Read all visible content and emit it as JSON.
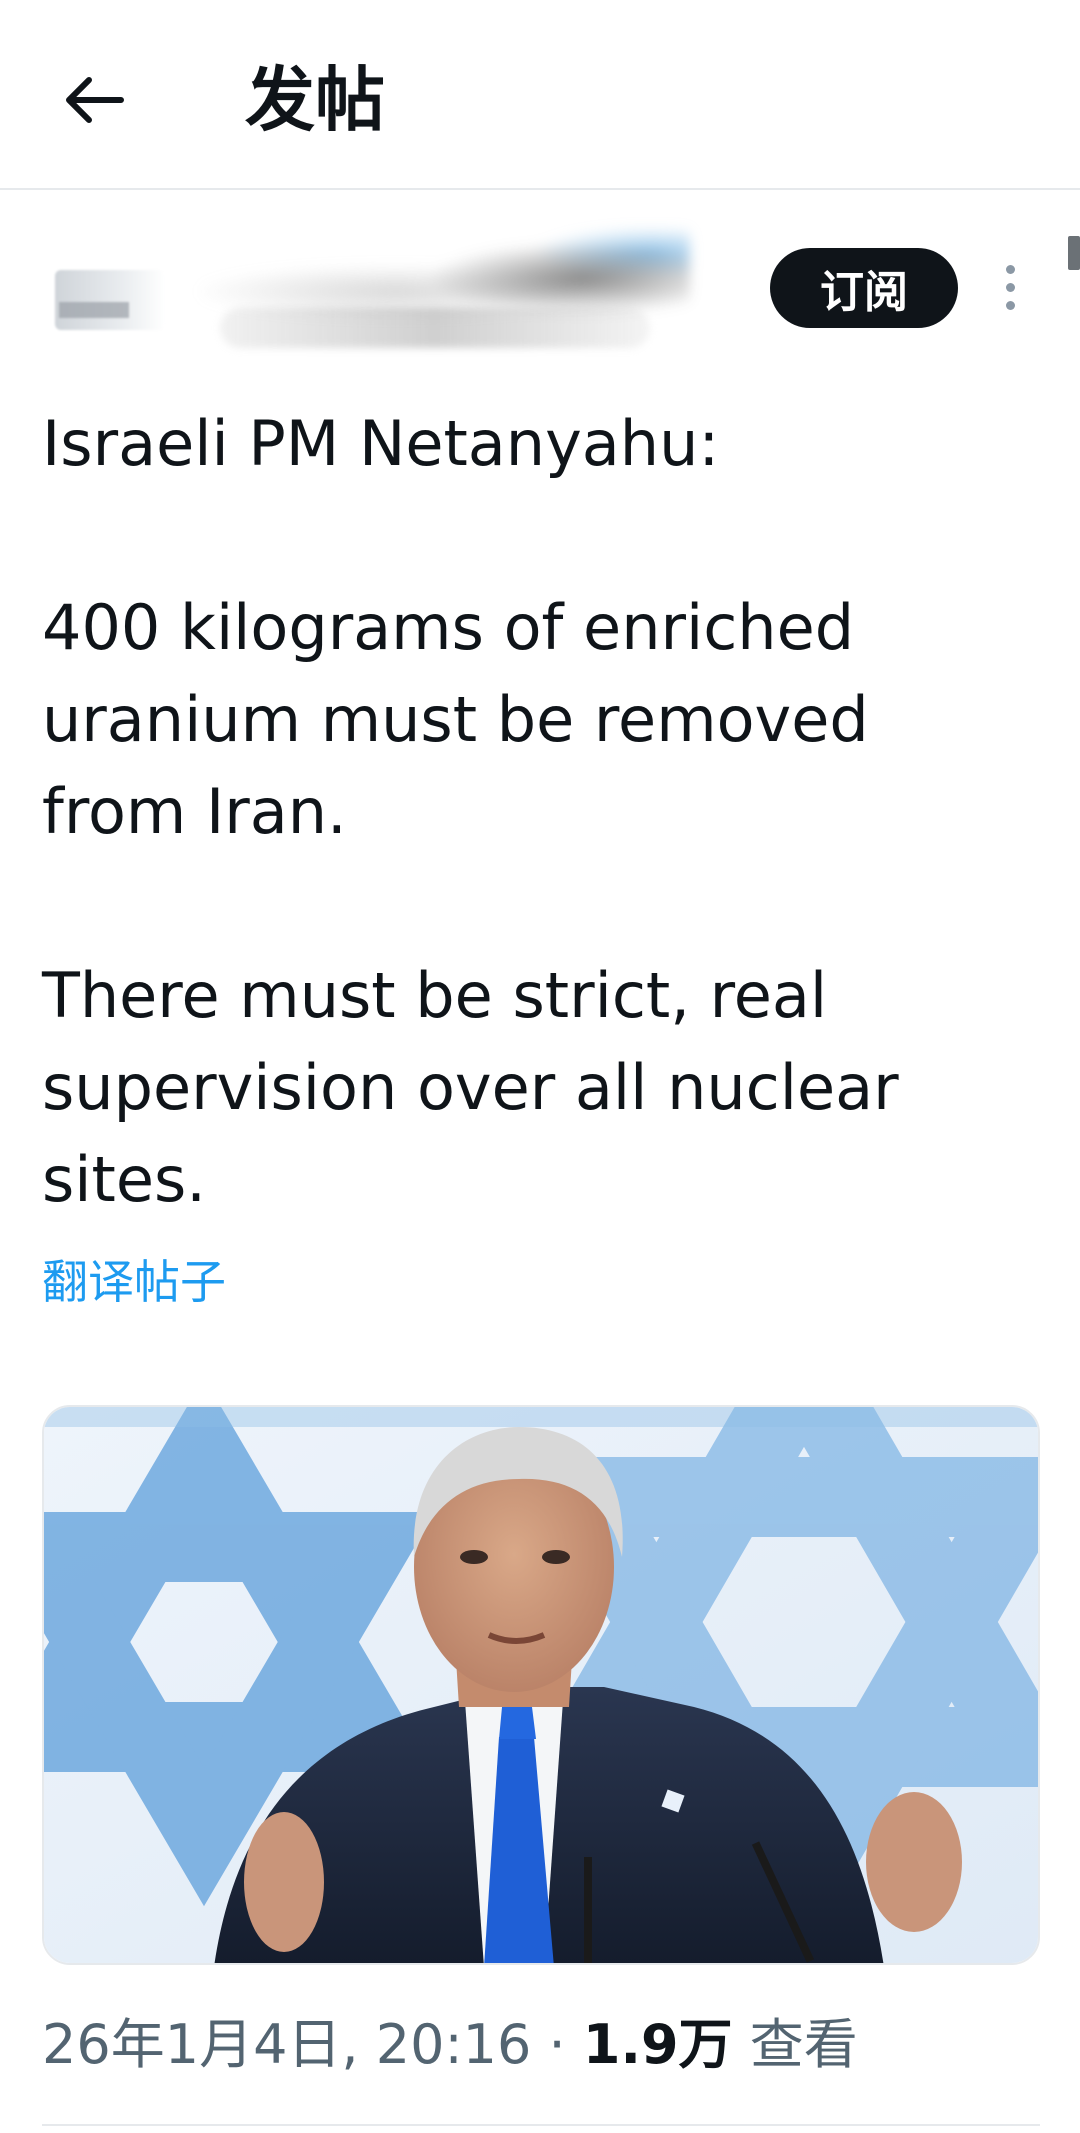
{
  "header": {
    "title": "发帖",
    "back_icon": "arrow-left-icon"
  },
  "author": {
    "subscribe_label": "订阅",
    "more_icon": "more-vertical-icon"
  },
  "post": {
    "paragraphs": [
      "Israeli PM Netanyahu:",
      "400 kilograms of enriched uranium must be removed from Iran.",
      "There must be strict, real supervision over all nuclear sites."
    ],
    "translate_label": "翻译帖子"
  },
  "meta": {
    "datetime": "26年1月4日, 20:16",
    "separator": "·",
    "views_count": "1.9万",
    "views_label": "查看"
  },
  "colors": {
    "text": "#0f1419",
    "secondary": "#536471",
    "link": "#1d9bf0",
    "divider": "#e6e9ec"
  }
}
